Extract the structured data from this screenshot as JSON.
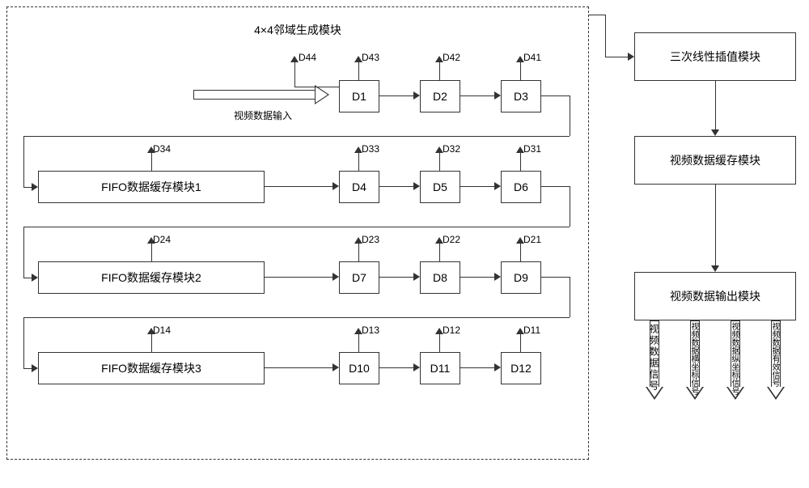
{
  "main": {
    "title": "4×4邻域生成模块",
    "input_label": "视频数据输入",
    "dregs": {
      "d1": "D1",
      "d2": "D2",
      "d3": "D3",
      "d4": "D4",
      "d5": "D5",
      "d6": "D6",
      "d7": "D7",
      "d8": "D8",
      "d9": "D9",
      "d10": "D10",
      "d11": "D11",
      "d12": "D12"
    },
    "outputs": {
      "r1": [
        "D44",
        "D43",
        "D42",
        "D41"
      ],
      "r2": [
        "D34",
        "D33",
        "D32",
        "D31"
      ],
      "r3": [
        "D24",
        "D23",
        "D22",
        "D21"
      ],
      "r4": [
        "D14",
        "D13",
        "D12",
        "D11"
      ]
    },
    "fifos": [
      "FIFO数据缓存模块1",
      "FIFO数据缓存模块2",
      "FIFO数据缓存模块3"
    ]
  },
  "right": {
    "box1": "三次线性插值模块",
    "box2": "视频数据缓存模块",
    "box3": "视频数据输出模块",
    "outputs": [
      "视频数据信号",
      "视频数据横坐标信号",
      "视频数据纵坐标信号",
      "视频数据有效信号"
    ]
  }
}
